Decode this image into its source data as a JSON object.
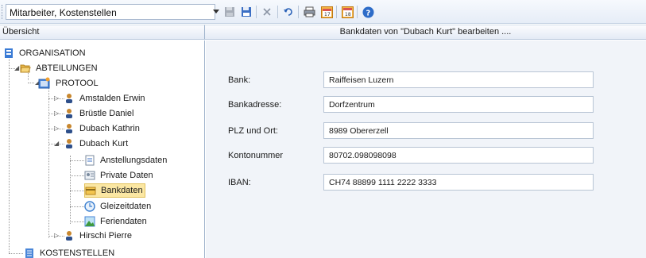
{
  "toolbar": {
    "view_select": "Mitarbeiter, Kostenstellen",
    "buttons": [
      "save-disabled-icon",
      "save-icon",
      "delete-icon",
      "undo-icon",
      "print-icon",
      "calendar-icon",
      "calendar-day-icon",
      "help-icon"
    ]
  },
  "left_panel": {
    "title": "Übersicht"
  },
  "right_panel": {
    "title": "Bankdaten von \"Dubach Kurt\" bearbeiten ...."
  },
  "tree": {
    "root": "ORGANISATION",
    "departments": "ABTEILUNGEN",
    "group": "PROTOOL",
    "employees": [
      "Amstalden Erwin",
      "Brüstle Daniel",
      "Dubach Kathrin",
      "Dubach Kurt",
      "Hirschi Pierre"
    ],
    "sub_items": [
      "Anstellungsdaten",
      "Private Daten",
      "Bankdaten",
      "Gleizeitdaten",
      "Feriendaten"
    ],
    "cost_centers": "KOSTENSTELLEN"
  },
  "form": {
    "fields": [
      {
        "label": "Bank:",
        "value": "Raiffeisen Luzern"
      },
      {
        "label": "Bankadresse:",
        "value": "Dorfzentrum"
      },
      {
        "label": "PLZ und Ort:",
        "value": "8989 Obererzell"
      },
      {
        "label": "Kontonummer",
        "value": "80702.098098098"
      },
      {
        "label": "IBAN:",
        "value": "CH74 88899 1111 2222 3333"
      }
    ]
  },
  "colors": {
    "selection": "#fbe7a3",
    "form_bg": "#f1f4f9",
    "toolbar_bg": "#e6edf7"
  }
}
